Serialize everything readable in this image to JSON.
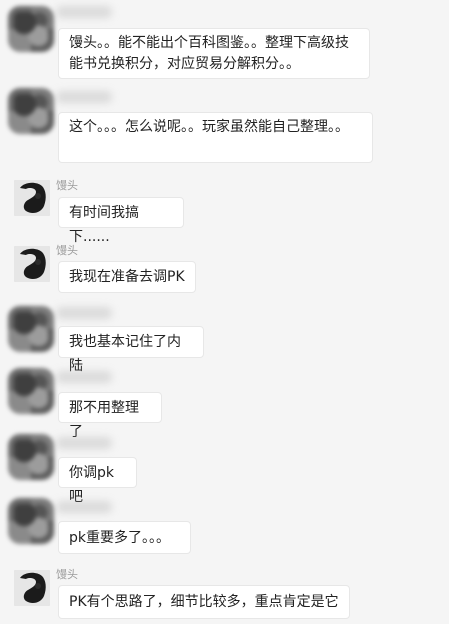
{
  "messages": [
    {
      "sender": "",
      "avatar": "blurred-avatar",
      "text": "馒头。。能不能出个百科图鉴。。整理下高级技能书兑换积分，对应贸易分解积分。。"
    },
    {
      "sender": "",
      "avatar": "blurred-avatar",
      "text": "这个。。。怎么说呢。。玩家虽然能自己整理。。"
    },
    {
      "sender": "馒头",
      "avatar": "photo-avatar",
      "text": "有时间我搞下......"
    },
    {
      "sender": "馒头",
      "avatar": "photo-avatar",
      "text": "我现在准备去调PK"
    },
    {
      "sender": "",
      "avatar": "blurred-avatar",
      "text": "我也基本记住了内陆"
    },
    {
      "sender": "",
      "avatar": "blurred-avatar",
      "text": "那不用整理了"
    },
    {
      "sender": "",
      "avatar": "blurred-avatar",
      "text": "你调pk吧"
    },
    {
      "sender": "",
      "avatar": "blurred-avatar",
      "text": "pk重要多了。。。"
    },
    {
      "sender": "馒头",
      "avatar": "photo-avatar",
      "text": "PK有个思路了，细节比较多，重点肯定是它"
    }
  ]
}
